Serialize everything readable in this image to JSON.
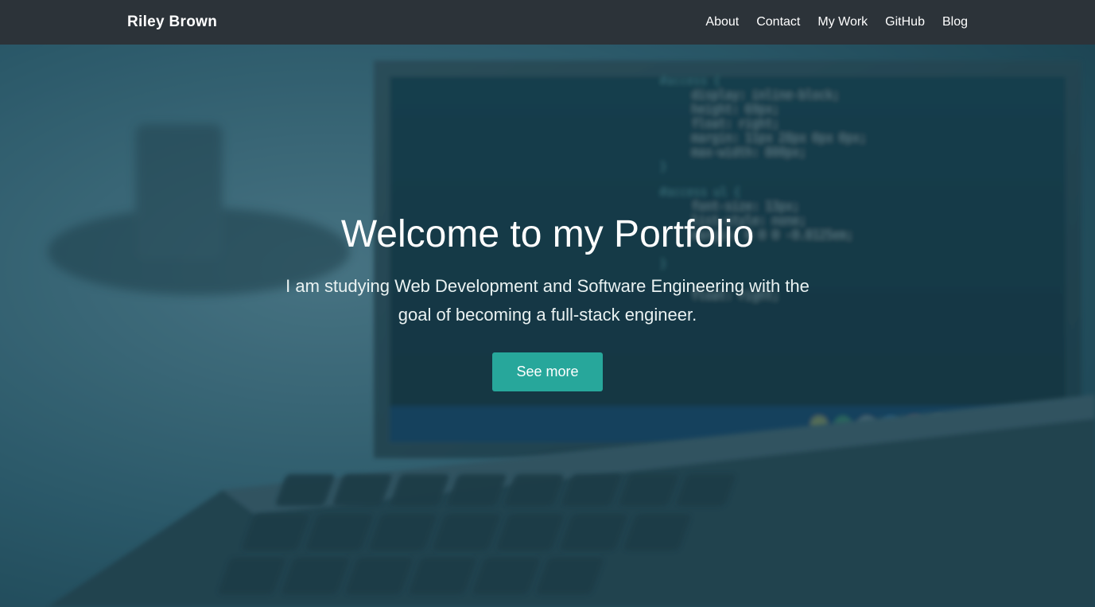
{
  "navbar": {
    "brand": "Riley Brown",
    "links": [
      {
        "label": "About"
      },
      {
        "label": "Contact"
      },
      {
        "label": "My Work"
      },
      {
        "label": "GitHub"
      },
      {
        "label": "Blog"
      }
    ]
  },
  "hero": {
    "title": "Welcome to my Portfolio",
    "subtitle": "I am studying Web Development and Software Engineering with the goal of becoming a full-stack engineer.",
    "button": "See more"
  },
  "colors": {
    "navbar_bg": "#2c3339",
    "button_bg": "#27a79b",
    "overlay": "rgba(30, 78, 95, 0.55)"
  }
}
